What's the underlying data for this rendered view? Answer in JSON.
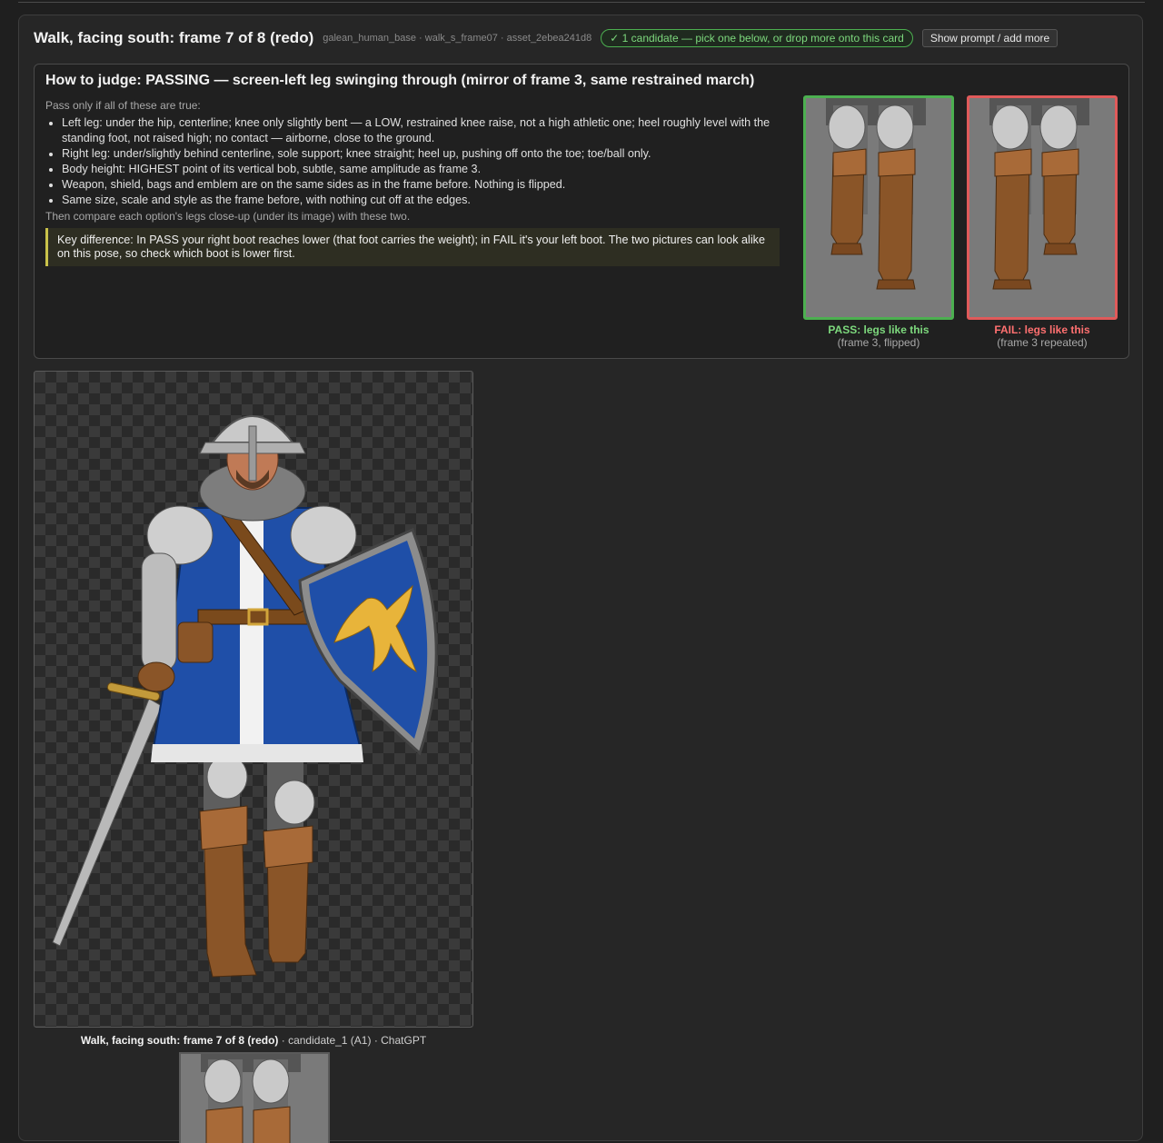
{
  "header": {
    "title": "Walk, facing south: frame 7 of 8 (redo)",
    "asset_ids": "galean_human_base · walk_s_frame07 · asset_2ebea241d8",
    "badge": "✓ 1 candidate — pick one below, or drop more onto this card",
    "prompt_button": "Show prompt / add more"
  },
  "judge": {
    "heading": "How to judge: PASSING — screen-left leg swinging through (mirror of frame 3, same restrained march)",
    "intro": "Pass only if all of these are true:",
    "criteria": [
      "Left leg: under the hip, centerline; knee only slightly bent — a LOW, restrained knee raise, not a high athletic one; heel roughly level with the standing foot, not raised high; no contact — airborne, close to the ground.",
      "Right leg: under/slightly behind centerline, sole support; knee straight; heel up, pushing off onto the toe; toe/ball only.",
      "Body height: HIGHEST point of its vertical bob, subtle, same amplitude as frame 3.",
      "Weapon, shield, bags and emblem are on the same sides as in the frame before. Nothing is flipped.",
      "Same size, scale and style as the frame before, with nothing cut off at the edges."
    ],
    "then": "Then compare each option's legs close-up (under its image) with these two.",
    "key_difference": "Key difference: In PASS your right boot reaches lower (that foot carries the weight); in FAIL it's your left boot. The two pictures can look alike on this pose, so check which boot is lower first."
  },
  "references": {
    "pass": {
      "label": "PASS: legs like this",
      "sub": "(frame 3, flipped)"
    },
    "fail": {
      "label": "FAIL: legs like this",
      "sub": "(frame 3 repeated)"
    }
  },
  "candidate": {
    "title": "Walk, facing south: frame 7 of 8 (redo)",
    "meta": " · candidate_1 (A1) · ChatGPT"
  },
  "colors": {
    "pass": "#4caf50",
    "fail": "#e05a5a",
    "tabard": "#1f4fa8",
    "emblem": "#e8b43a"
  }
}
